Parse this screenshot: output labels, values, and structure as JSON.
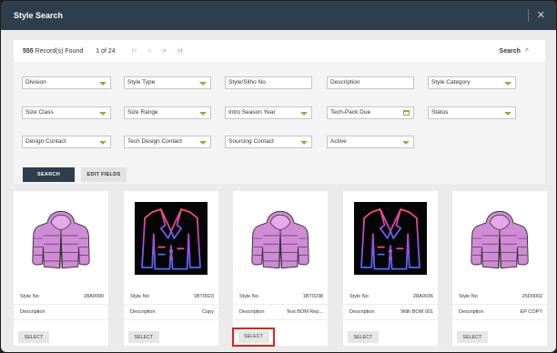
{
  "window": {
    "title": "Style Search",
    "close_icon": "close-icon"
  },
  "header": {
    "count": "555",
    "count_label": "Record(s) Found",
    "page": "1 of 24",
    "nav": [
      "|<",
      "<",
      ">",
      ">|"
    ],
    "search_toggle": "Search",
    "search_toggle_icon": "^"
  },
  "filters": [
    [
      "Division",
      "Style Type",
      "Style/Silho No",
      "Description",
      "Style Category"
    ],
    [
      "Size Class",
      "Size Range",
      "Intro Season Year",
      "Tech-Pack Due",
      "Status"
    ],
    [
      "Design Contact",
      "Tech Design Contact",
      "Sourcing Contact",
      "Active"
    ]
  ],
  "buttons": {
    "search": "SEARCH",
    "edit_fields": "EDIT FIELDS"
  },
  "cards": [
    {
      "style_no_label": "Style No",
      "style_no": "28A0090",
      "desc_label": "Description",
      "desc": "",
      "select": "SELECT",
      "image": "pink-puffer-jacket"
    },
    {
      "style_no_label": "Style No",
      "style_no": "1BT0023",
      "desc_label": "Description",
      "desc": "Copy",
      "select": "SELECT",
      "image": "neon-blazer"
    },
    {
      "style_no_label": "Style No",
      "style_no": "1BT0238",
      "desc_label": "Description",
      "desc": "Test BOM Rep...",
      "select": "SELECT",
      "image": "pink-puffer-jacket"
    },
    {
      "style_no_label": "Style No",
      "style_no": "28A0036",
      "desc_label": "Description",
      "desc": "With BOM 001",
      "select": "SELECT",
      "image": "neon-blazer"
    },
    {
      "style_no_label": "Style No",
      "style_no": "25D0002",
      "desc_label": "Description",
      "desc": "EP COPY",
      "select": "SELECT",
      "image": "pink-puffer-jacket"
    }
  ],
  "colors": {
    "titlebar": "#2f3e4c",
    "accent_green": "#8bb13a",
    "highlight": "#e0211c",
    "jacket": "#d08ad6"
  }
}
